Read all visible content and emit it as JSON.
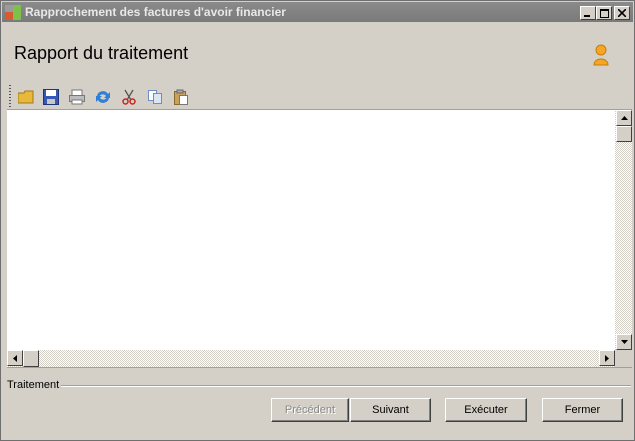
{
  "window": {
    "title": "Rapprochement des factures d'avoir financier",
    "minimize_label": "_",
    "maximize_label": "□",
    "close_label": "✕"
  },
  "header": {
    "title": "Rapport du traitement"
  },
  "toolbar": {
    "items": [
      {
        "name": "open-folder-icon"
      },
      {
        "name": "save-icon"
      },
      {
        "name": "print-icon"
      },
      {
        "name": "refresh-icon"
      },
      {
        "name": "cut-icon"
      },
      {
        "name": "copy-icon"
      },
      {
        "name": "paste-icon"
      }
    ]
  },
  "group": {
    "label": "Traitement"
  },
  "buttons": {
    "previous": "Précédent",
    "next": "Suivant",
    "execute": "Exécuter",
    "close": "Fermer"
  }
}
